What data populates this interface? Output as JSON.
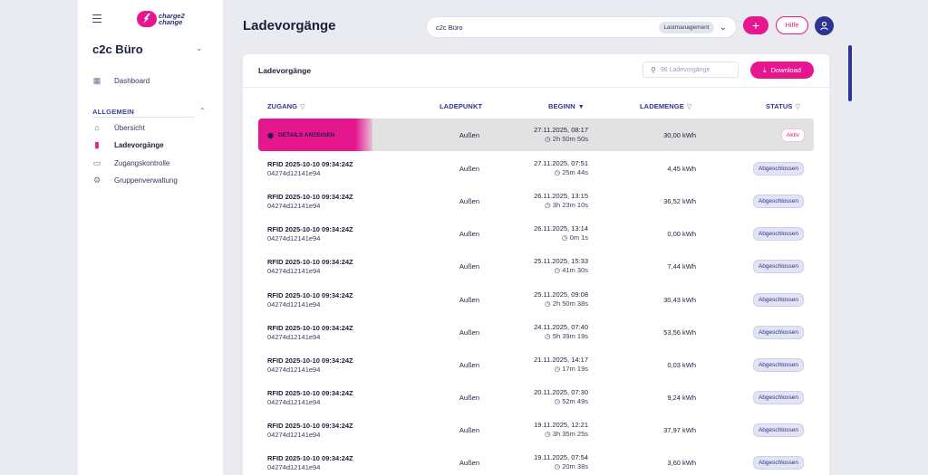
{
  "sidebar": {
    "logo_line1": "charge2",
    "logo_line2": "change",
    "org_name": "c2c Büro",
    "dashboard": "Dashboard",
    "section_label": "ALLGEMEIN",
    "items": [
      {
        "label": "Übersicht",
        "icon": "home-icon"
      },
      {
        "label": "Ladevorgänge",
        "icon": "charging-station-icon"
      },
      {
        "label": "Zugangskontrolle",
        "icon": "card-icon"
      },
      {
        "label": "Gruppenverwaltung",
        "icon": "gear-icon"
      }
    ],
    "accent_color": "#e6168f"
  },
  "header": {
    "title": "Ladevorgänge",
    "location_value": "c2c Büro",
    "location_badge": "Lastmanagement",
    "add_label": "+",
    "help_label": "Hilfe"
  },
  "card": {
    "title": "Ladevorgänge",
    "search_placeholder": "96 Ladevorgänge",
    "download_label": "Download",
    "columns": {
      "zugang": "ZUGANG",
      "ladepunkt": "LADEPUNKT",
      "beginn": "BEGINN",
      "lademenge": "LADEMENGE",
      "status": "STATUS"
    },
    "details_label": "DETAILS ANZEIGEN",
    "rows": [
      {
        "id": "",
        "sub": "",
        "ladepunkt": "Außen",
        "date": "27.11.2025, 08:17",
        "duration": "2h 50m 50s",
        "energy": "30,00 kWh",
        "status": "Aktiv"
      },
      {
        "id": "RFID 2025-10-10 09:34:24Z",
        "sub": "04274d12141e94",
        "ladepunkt": "Außen",
        "date": "27.11.2025, 07:51",
        "duration": "25m 44s",
        "energy": "4,45 kWh",
        "status": "Abgeschlossen"
      },
      {
        "id": "RFID 2025-10-10 09:34:24Z",
        "sub": "04274d12141e94",
        "ladepunkt": "Außen",
        "date": "26.11.2025, 13:15",
        "duration": "3h 23m 10s",
        "energy": "36,52 kWh",
        "status": "Abgeschlossen"
      },
      {
        "id": "RFID 2025-10-10 09:34:24Z",
        "sub": "04274d12141e94",
        "ladepunkt": "Außen",
        "date": "26.11.2025, 13:14",
        "duration": "0m 1s",
        "energy": "0,00 kWh",
        "status": "Abgeschlossen"
      },
      {
        "id": "RFID 2025-10-10 09:34:24Z",
        "sub": "04274d12141e94",
        "ladepunkt": "Außen",
        "date": "25.11.2025, 15:33",
        "duration": "41m 30s",
        "energy": "7,44 kWh",
        "status": "Abgeschlossen"
      },
      {
        "id": "RFID 2025-10-10 09:34:24Z",
        "sub": "04274d12141e94",
        "ladepunkt": "Außen",
        "date": "25.11.2025, 09:08",
        "duration": "2h 50m 38s",
        "energy": "30,43 kWh",
        "status": "Abgeschlossen"
      },
      {
        "id": "RFID 2025-10-10 09:34:24Z",
        "sub": "04274d12141e94",
        "ladepunkt": "Außen",
        "date": "24.11.2025, 07:40",
        "duration": "5h 39m 19s",
        "energy": "53,56 kWh",
        "status": "Abgeschlossen"
      },
      {
        "id": "RFID 2025-10-10 09:34:24Z",
        "sub": "04274d12141e94",
        "ladepunkt": "Außen",
        "date": "21.11.2025, 14:17",
        "duration": "17m 19s",
        "energy": "0,03 kWh",
        "status": "Abgeschlossen"
      },
      {
        "id": "RFID 2025-10-10 09:34:24Z",
        "sub": "04274d12141e94",
        "ladepunkt": "Außen",
        "date": "20.11.2025, 07:30",
        "duration": "52m 49s",
        "energy": "9,24 kWh",
        "status": "Abgeschlossen"
      },
      {
        "id": "RFID 2025-10-10 09:34:24Z",
        "sub": "04274d12141e94",
        "ladepunkt": "Außen",
        "date": "19.11.2025, 12:21",
        "duration": "3h 35m 25s",
        "energy": "37,97 kWh",
        "status": "Abgeschlossen"
      },
      {
        "id": "RFID 2025-10-10 09:34:24Z",
        "sub": "04274d12141e94",
        "ladepunkt": "Außen",
        "date": "19.11.2025, 07:54",
        "duration": "20m 38s",
        "energy": "3,60 kWh",
        "status": "Abgeschlossen"
      }
    ]
  }
}
